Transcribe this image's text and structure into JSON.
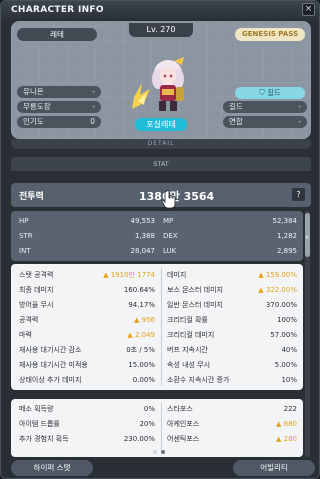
{
  "window": {
    "title": "CHARACTER INFO",
    "close": "×"
  },
  "character": {
    "name": "레테",
    "level": "Lv. 270",
    "badge": "GENESIS PASS",
    "guild_button": "길드",
    "job": "포실레테",
    "left_rows": [
      {
        "label": "유니온",
        "value": "-"
      },
      {
        "label": "무릉도장",
        "value": "-"
      },
      {
        "label": "인기도",
        "value": "0"
      }
    ],
    "right_rows": [
      {
        "label": "길드",
        "value": "-"
      },
      {
        "label": "연합",
        "value": "-"
      }
    ]
  },
  "detail_label": "DETAIL",
  "stat": {
    "header": "STAT",
    "power_label": "전투력",
    "power_value": "1386만 3564",
    "help": "?",
    "basic": [
      {
        "label": "HP",
        "value": "49,553"
      },
      {
        "label": "MP",
        "value": "52,384"
      },
      {
        "label": "STR",
        "value": "1,388"
      },
      {
        "label": "DEX",
        "value": "1,282"
      },
      {
        "label": "INT",
        "value": "28,047"
      },
      {
        "label": "LUK",
        "value": "2,895"
      }
    ],
    "main_left": [
      {
        "label": "스탯 공격력",
        "value": "▲ 1910만 1774"
      },
      {
        "label": "최종 데미지",
        "value": "160.64%"
      },
      {
        "label": "방어율 무시",
        "value": "94.17%"
      },
      {
        "label": "공격력",
        "value": "▲ 956"
      },
      {
        "label": "마력",
        "value": "▲ 2,049"
      },
      {
        "label": "재사용 대기시간 감소",
        "value": "0초 / 5%"
      },
      {
        "label": "재사용 대기시간 미적용",
        "value": "15.00%"
      },
      {
        "label": "상태이상 추가 데미지",
        "value": "0.00%"
      }
    ],
    "main_right": [
      {
        "label": "데미지",
        "value": "▲ 159.00%"
      },
      {
        "label": "보스 몬스터 데미지",
        "value": "▲ 322.00%"
      },
      {
        "label": "일반 몬스터 데미지",
        "value": "370.00%"
      },
      {
        "label": "크리티컬 확률",
        "value": "100%"
      },
      {
        "label": "크리티컬 데미지",
        "value": "57.00%"
      },
      {
        "label": "버프 지속시간",
        "value": "40%"
      },
      {
        "label": "속성 내성 무시",
        "value": "5.00%"
      },
      {
        "label": "소환수 지속시간 증가",
        "value": "10%"
      }
    ],
    "misc_left": [
      {
        "label": "메소 획득량",
        "value": "0%"
      },
      {
        "label": "아이템 드롭률",
        "value": "20%"
      },
      {
        "label": "추가 경험치 획득",
        "value": "230.00%"
      }
    ],
    "misc_right": [
      {
        "label": "스타포스",
        "value": "222"
      },
      {
        "label": "아케인포스",
        "value": "▲ 880"
      },
      {
        "label": "어센틱포스",
        "value": "▲ 280"
      }
    ]
  },
  "buttons": {
    "hyper_stat": "하이퍼 스탯",
    "ability": "어빌리티"
  },
  "colors": {
    "accent": "#22bcd8",
    "gold": "#e5a31c",
    "panel": "#2a2f36"
  }
}
